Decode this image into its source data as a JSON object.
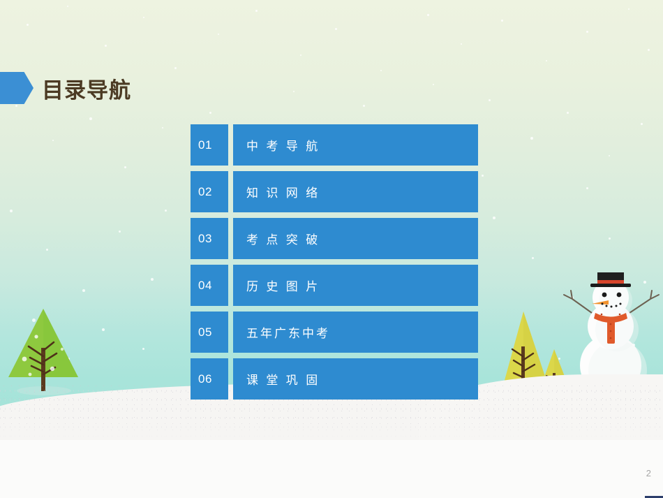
{
  "slide": {
    "heading": {
      "title": "目录导航",
      "arrow_icon": "arrow-marker-icon",
      "accent_color": "#3b8fd4",
      "title_color": "#4b3a23"
    },
    "menu": {
      "block_color": "#2e8bd0",
      "items": [
        {
          "number": "01",
          "label": "中 考 导 航"
        },
        {
          "number": "02",
          "label": "知 识 网 络"
        },
        {
          "number": "03",
          "label": "考 点 突 破"
        },
        {
          "number": "04",
          "label": "历 史 图 片"
        },
        {
          "number": "05",
          "label": "五年广东中考"
        },
        {
          "number": "06",
          "label": "课 堂 巩 固"
        }
      ]
    },
    "footer": {
      "page_number": "2"
    },
    "scene": {
      "description": "winter-snow-scene",
      "sky_top_color": "#eef3e1",
      "sky_bottom_color": "#a3e2d8",
      "snow_color": "#f6f5f3",
      "snowman": {
        "hat_color": "#1f1f1f",
        "scarf_color": "#e05a2b",
        "nose_color": "#f2922c"
      },
      "trees": [
        {
          "name": "pine-tree-left",
          "color": "#8ec93f"
        },
        {
          "name": "pine-tree-right-tall",
          "color": "#dbd74a"
        },
        {
          "name": "pine-tree-right-small",
          "color": "#dbd74a"
        }
      ]
    }
  }
}
